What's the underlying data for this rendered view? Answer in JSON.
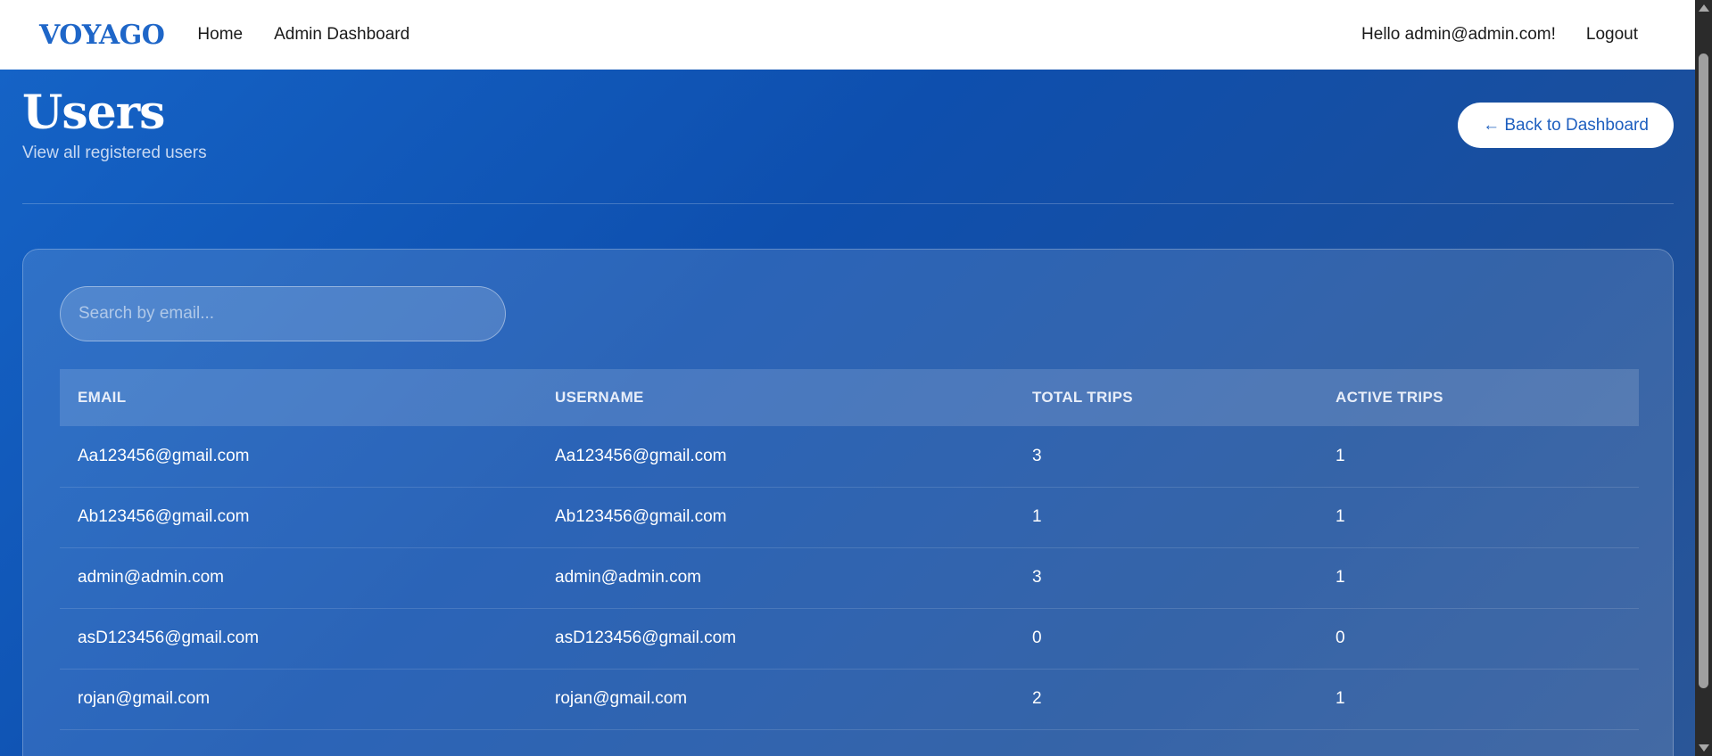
{
  "nav": {
    "brand": "VOYAGO",
    "links": [
      "Home",
      "Admin Dashboard"
    ],
    "greeting": "Hello admin@admin.com!",
    "logout": "Logout"
  },
  "header": {
    "title": "Users",
    "subtitle": "View all registered users",
    "back_button": "← Back to Dashboard"
  },
  "search": {
    "placeholder": "Search by email...",
    "value": ""
  },
  "table": {
    "columns": [
      "EMAIL",
      "USERNAME",
      "TOTAL TRIPS",
      "ACTIVE TRIPS"
    ],
    "rows": [
      [
        "Aa123456@gmail.com",
        "Aa123456@gmail.com",
        "3",
        "1"
      ],
      [
        "Ab123456@gmail.com",
        "Ab123456@gmail.com",
        "1",
        "1"
      ],
      [
        "admin@admin.com",
        "admin@admin.com",
        "3",
        "1"
      ],
      [
        "asD123456@gmail.com",
        "asD123456@gmail.com",
        "0",
        "0"
      ],
      [
        "rojan@gmail.com",
        "rojan@gmail.com",
        "2",
        "1"
      ]
    ]
  },
  "colors": {
    "brand": "#1e66c8",
    "background_start": "#1563c6",
    "background_end": "#2a5698",
    "button_text": "#1e5fbf"
  }
}
